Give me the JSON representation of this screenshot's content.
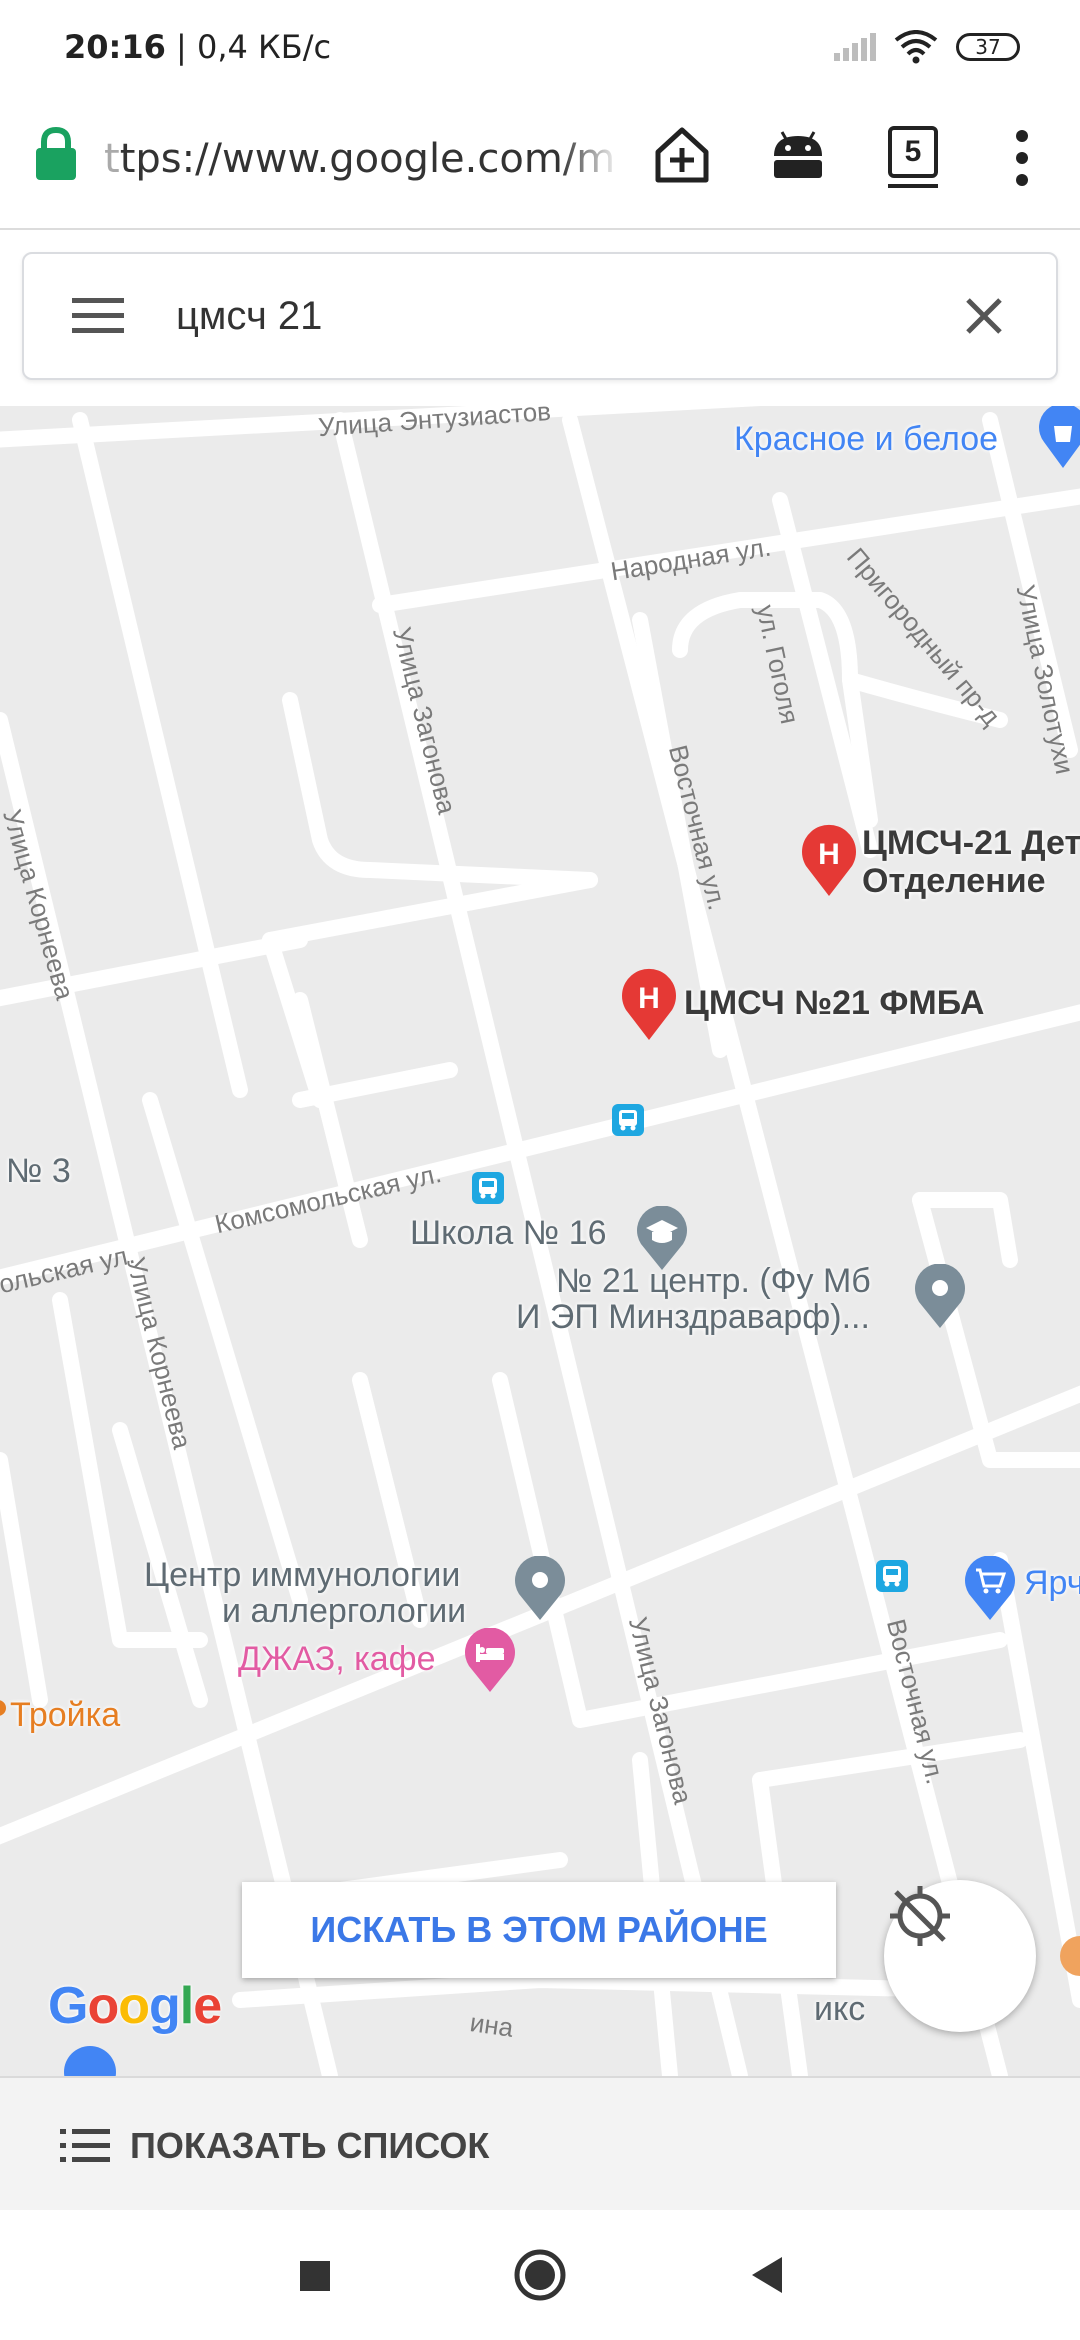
{
  "status_bar": {
    "time": "20:16",
    "speed": "| 0,4 КБ/с",
    "battery": "37"
  },
  "browser": {
    "url_faded": "t",
    "url": "tps://www.google.com/m",
    "tab_count": "5"
  },
  "search": {
    "query": "цмсч 21"
  },
  "map": {
    "streets": {
      "entuziastov": "Улица Энтузиастов",
      "narodnaya": "Народная ул.",
      "gogolya": "ул. Гоголя",
      "prigorodny": "Пригородный пр-д",
      "zolotukhi": "Улица Золотухи",
      "zagonova_1": "Улица Загонова",
      "vostochnaya_1": "Восточная ул.",
      "korneeva_1": "Улица Корнеева",
      "komsomolskaya_1": "Комсомольская ул.",
      "komsomolskaya_2": "ольская ул.",
      "korneeva_2": "Улица Корнеева",
      "zagonova_2": "Улица Загонова",
      "vostochnaya_2": "Восточная ул.",
      "bottom_partial": "ина"
    },
    "pois": {
      "krasnoe_beloe": "Красное и белое",
      "cmsch_det_1": "ЦМСЧ-21 Дет",
      "cmsch_det_2": "Отделение",
      "cmsch_fmba": "ЦМСЧ №21 ФМБА",
      "no3": "№ 3",
      "school": "Школа № 16",
      "center21_1": "№ 21 центр. (Фу Мб",
      "center21_2": "И ЭП Минздраварф)...",
      "immuno_1": "Центр иммунологии",
      "immuno_2": "и аллергологии",
      "jazz": "ДЖАЗ, кафе",
      "troika": "Тройка",
      "yarche": "Ярч",
      "fix": "икс"
    },
    "search_area_label": "ИСКАТЬ В ЭТОМ РАЙОНЕ",
    "logo": {
      "g": "G",
      "o1": "o",
      "o2": "o",
      "g2": "g",
      "l": "l",
      "e": "e"
    },
    "colors": {
      "land": "#ebebeb",
      "road": "#ffffff",
      "hospital_pin": "#e53935",
      "generic_pin": "#7b8d99",
      "shop_pin": "#4285f4",
      "food_pin": "#e25ba3",
      "transit": "#1ea7e1"
    }
  },
  "list_bar": {
    "label": "ПОКАЗАТЬ СПИСОК"
  }
}
